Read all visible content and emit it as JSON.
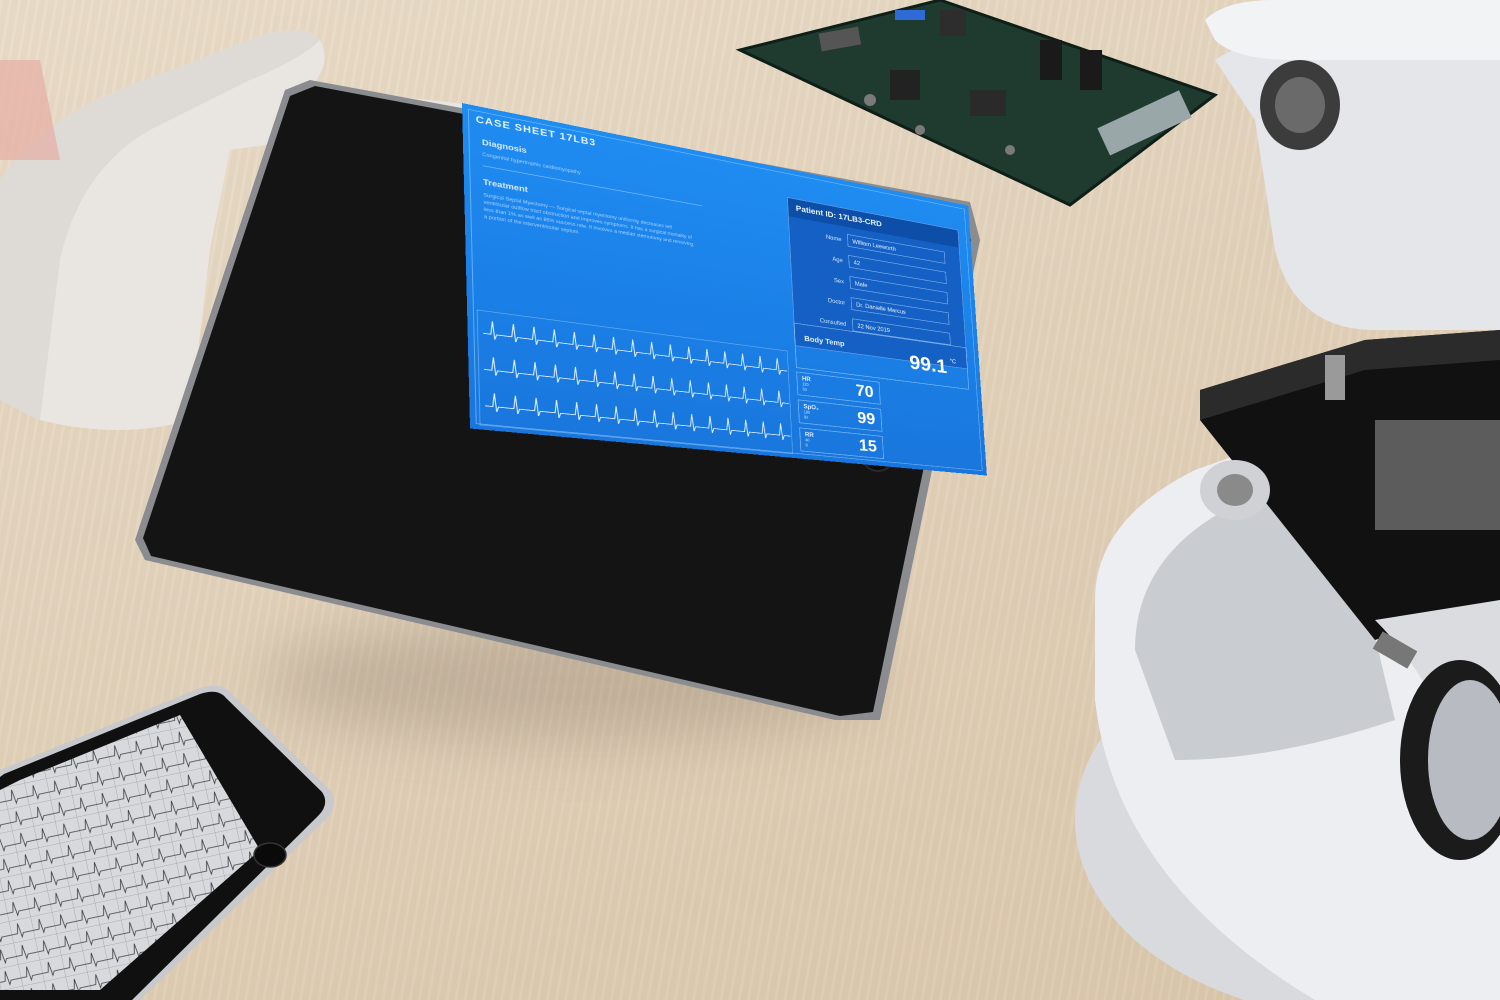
{
  "tablet_screen": {
    "sheet_title": "CASE SHEET 17LB3",
    "diagnosis": {
      "heading": "Diagnosis",
      "text": "Congenital hypertrophic cardiomyopathy"
    },
    "treatment": {
      "heading": "Treatment",
      "text": "Surgical Septal Myectomy — Surgical septal myectomy uniformly decreases left ventricular outflow tract obstruction and improves symptoms. It has a surgical mortality of less than 1% as well as 85% success rate. It involves a median sternotomy and removing a portion of the interventricular septum."
    },
    "patient": {
      "id_label": "Patient ID: 17LB3-CRD",
      "fields": [
        {
          "label": "Name",
          "value": "William Leeworth"
        },
        {
          "label": "Age",
          "value": "42"
        },
        {
          "label": "Sex",
          "value": "Male"
        },
        {
          "label": "Doctor",
          "value": "Dr. Danielle Marcus"
        },
        {
          "label": "Consulted",
          "value": "22 Nov 2019"
        }
      ]
    },
    "body_temp": {
      "label": "Body Temp",
      "value": "99.1",
      "unit": "°C"
    },
    "vitals": [
      {
        "name": "HR",
        "high": "120",
        "low": "50",
        "value": "70"
      },
      {
        "name": "SpO₂",
        "high": "100",
        "low": "92",
        "value": "99"
      },
      {
        "name": "RR",
        "high": "40",
        "low": "8",
        "value": "15"
      }
    ]
  },
  "colors": {
    "screen_blue": "#1f8cf2",
    "panel_dark_blue": "#0d4fa8",
    "desk": "#e2d2bb",
    "device_black": "#141414"
  },
  "icons": [
    "home-button",
    "stethoscope",
    "circuit-board",
    "microscope",
    "phone-ecg-grid"
  ]
}
